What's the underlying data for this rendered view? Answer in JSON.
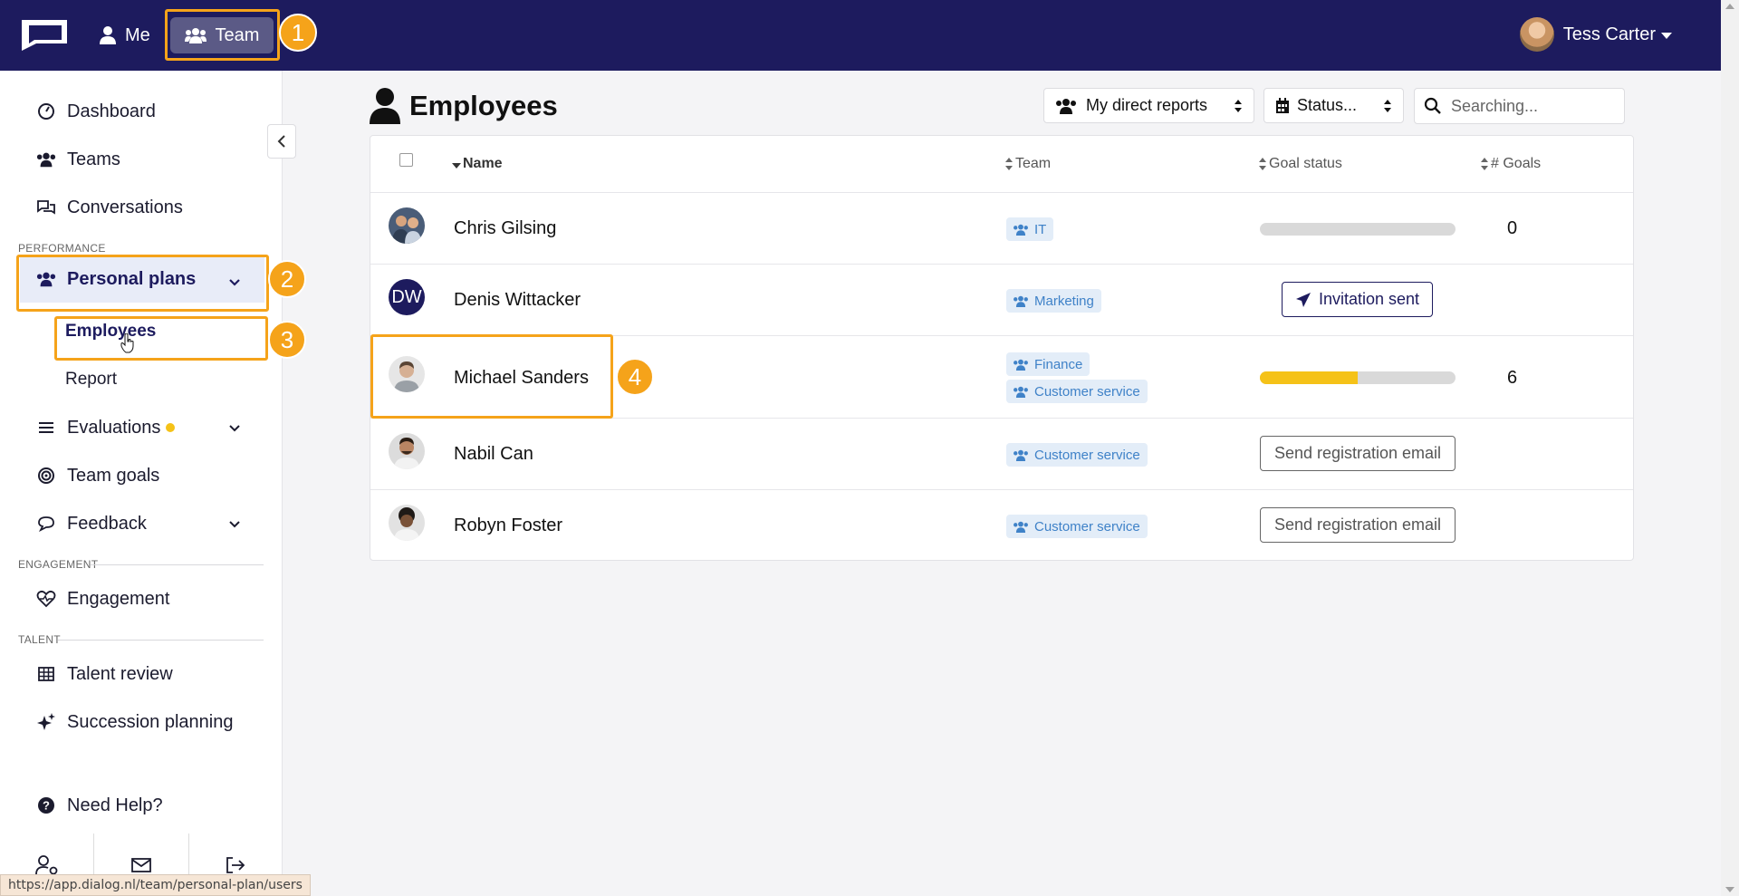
{
  "topbar": {
    "me_label": "Me",
    "team_label": "Team",
    "user_name": "Tess Carter"
  },
  "sidebar": {
    "items": [
      {
        "label": "Dashboard",
        "icon": "gauge-icon"
      },
      {
        "label": "Teams",
        "icon": "users-icon"
      },
      {
        "label": "Conversations",
        "icon": "comments-icon"
      }
    ],
    "section_performance": "PERFORMANCE",
    "personal_plans": "Personal plans",
    "sub_employees": "Employees",
    "sub_report": "Report",
    "evaluations": "Evaluations",
    "team_goals": "Team goals",
    "feedback": "Feedback",
    "section_engagement": "ENGAGEMENT",
    "engagement": "Engagement",
    "section_talent": "TALENT",
    "talent_review": "Talent review",
    "succession_planning": "Succession planning",
    "need_help": "Need Help?"
  },
  "main": {
    "title": "Employees",
    "filter_reports": "My direct reports",
    "filter_status": "Status...",
    "search_placeholder": "Searching...",
    "columns": {
      "name": "Name",
      "team": "Team",
      "goal_status": "Goal status",
      "goals": "# Goals"
    },
    "rows": [
      {
        "name": "Chris Gilsing",
        "teams": [
          "IT"
        ],
        "progress": 0,
        "goals": "0"
      },
      {
        "name": "Denis Wittacker",
        "initials": "DW",
        "teams": [
          "Marketing"
        ],
        "action": "Invitation sent"
      },
      {
        "name": "Michael Sanders",
        "teams": [
          "Finance",
          "Customer service"
        ],
        "progress": 0.5,
        "goals": "6"
      },
      {
        "name": "Nabil Can",
        "teams": [
          "Customer service"
        ],
        "action": "Send registration email"
      },
      {
        "name": "Robyn Foster",
        "teams": [
          "Customer service"
        ],
        "action": "Send registration email"
      }
    ]
  },
  "status_url": "https://app.dialog.nl/team/personal-plan/users",
  "annotations": [
    "1",
    "2",
    "3",
    "4"
  ],
  "colors": {
    "nav": "#1d1b5e",
    "accent": "#f5a31a",
    "progress": "#f5c218",
    "tag_bg": "#e3edf8",
    "tag_text": "#3f82c8"
  }
}
